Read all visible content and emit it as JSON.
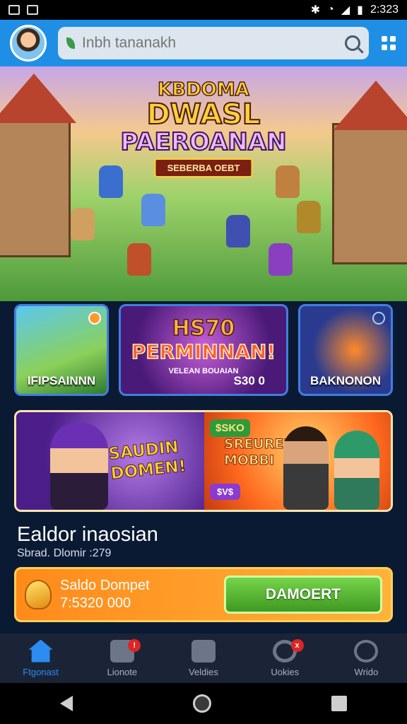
{
  "status_bar": {
    "time": "2:323"
  },
  "header": {
    "search_placeholder": "Inbh tananakh"
  },
  "hero": {
    "line1": "KBDOMA",
    "line2": "DWASL",
    "line3": "PAEROANAN",
    "ribbon": "SEBERBA OEBT"
  },
  "cards": [
    {
      "caption": "IFIPSAINNN"
    },
    {
      "title1": "HS70",
      "title2": "PERMINNAN!",
      "subtitle": "VELEAN BOUAIAN",
      "price": "S30 0"
    },
    {
      "caption": "BAKNONON"
    }
  ],
  "promo": {
    "left_text": [
      "SAUDIN",
      "DOMEN!"
    ],
    "right_tag": "$SKO",
    "right_text": [
      "SREUREH",
      "MOBBI"
    ],
    "right_tag2": "$V$"
  },
  "section": {
    "title": "Ealdor inaosian",
    "subtitle": "Sbrad. Dlomir :279"
  },
  "wallet": {
    "label": "Saldo Dompet",
    "amount": "7:5320 000",
    "button": "DAMOERT"
  },
  "tabbar": [
    {
      "label": "Ftgonast",
      "icon": "home-icon"
    },
    {
      "label": "Lionote",
      "icon": "gamepad-icon",
      "badge": "!"
    },
    {
      "label": "Veldies",
      "icon": "controller-icon"
    },
    {
      "label": "Uokies",
      "icon": "settings-icon",
      "badge": "x"
    },
    {
      "label": "Wrido",
      "icon": "profile-icon"
    }
  ],
  "colors": {
    "primary": "#1f8fe6",
    "accent": "#ff8a1a",
    "active_tab": "#2b8cf2"
  }
}
